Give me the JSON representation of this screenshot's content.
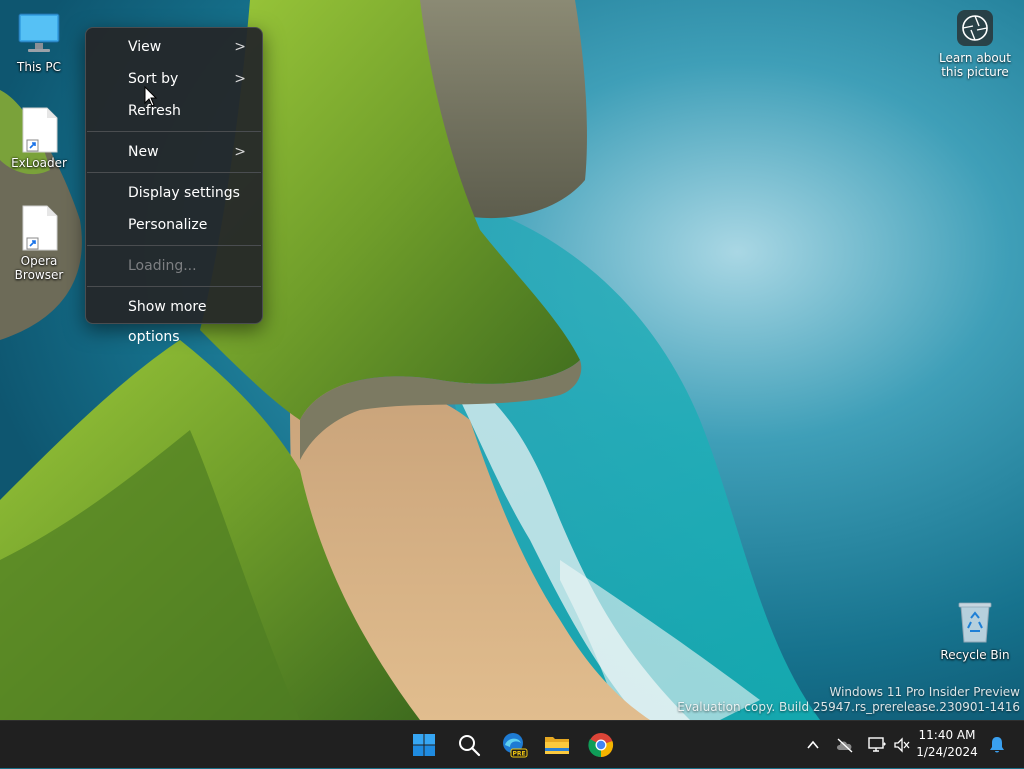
{
  "desktop": {
    "icons": [
      {
        "label": "This PC"
      },
      {
        "label": "ExLoader"
      },
      {
        "label": "Opera Browser"
      },
      {
        "label": "Recycle Bin"
      }
    ],
    "learn_label": "Learn about this picture"
  },
  "context_menu": {
    "items": [
      {
        "label": "View",
        "has_submenu": true
      },
      {
        "label": "Sort by",
        "has_submenu": true
      },
      {
        "label": "Refresh"
      },
      {
        "label": "New",
        "has_submenu": true
      },
      {
        "label": "Display settings"
      },
      {
        "label": "Personalize"
      },
      {
        "label": "Loading...",
        "disabled": true
      },
      {
        "label": "Show more options"
      }
    ],
    "chevron": ">"
  },
  "watermark": {
    "line1": "Windows 11 Pro Insider Preview",
    "line2": "Evaluation copy. Build 25947.rs_prerelease.230901-1416"
  },
  "taskbar": {
    "apps": [
      {
        "name": "start-icon"
      },
      {
        "name": "search-icon"
      },
      {
        "name": "edge-beta-icon",
        "badge": "PRE"
      },
      {
        "name": "file-explorer-icon"
      },
      {
        "name": "chrome-icon"
      }
    ],
    "clock": {
      "time": "11:40 AM",
      "date": "1/24/2024"
    }
  },
  "colors": {
    "accent": "#0078d4",
    "taskbar_bg": "#202020",
    "menu_bg": "#242628"
  }
}
